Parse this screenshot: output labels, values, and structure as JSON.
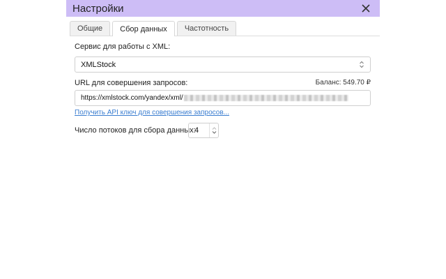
{
  "dialog": {
    "title": "Настройки"
  },
  "tabs": [
    {
      "label": "Общие",
      "active": false
    },
    {
      "label": "Сбор данных",
      "active": true
    },
    {
      "label": "Частотность",
      "active": false
    }
  ],
  "service": {
    "label": "Сервис для работы с XML:",
    "selected": "XMLStock"
  },
  "url": {
    "label": "URL для совершения запросов:",
    "balance": "Баланс: 549.70 ₽",
    "value": "https://xmlstock.com/yandex/xml/"
  },
  "api_link": "Получить API ключ для совершения запросов...",
  "threads": {
    "label": "Число потоков для сбора данных:",
    "value": "4"
  },
  "colors": {
    "titlebar": "#cdbdf6",
    "link": "#3a7dd0"
  },
  "icons": {
    "close": "close-icon",
    "select_arrows": "chevron-updown-icon",
    "stepper_up": "chevron-up-icon",
    "stepper_down": "chevron-down-icon"
  }
}
